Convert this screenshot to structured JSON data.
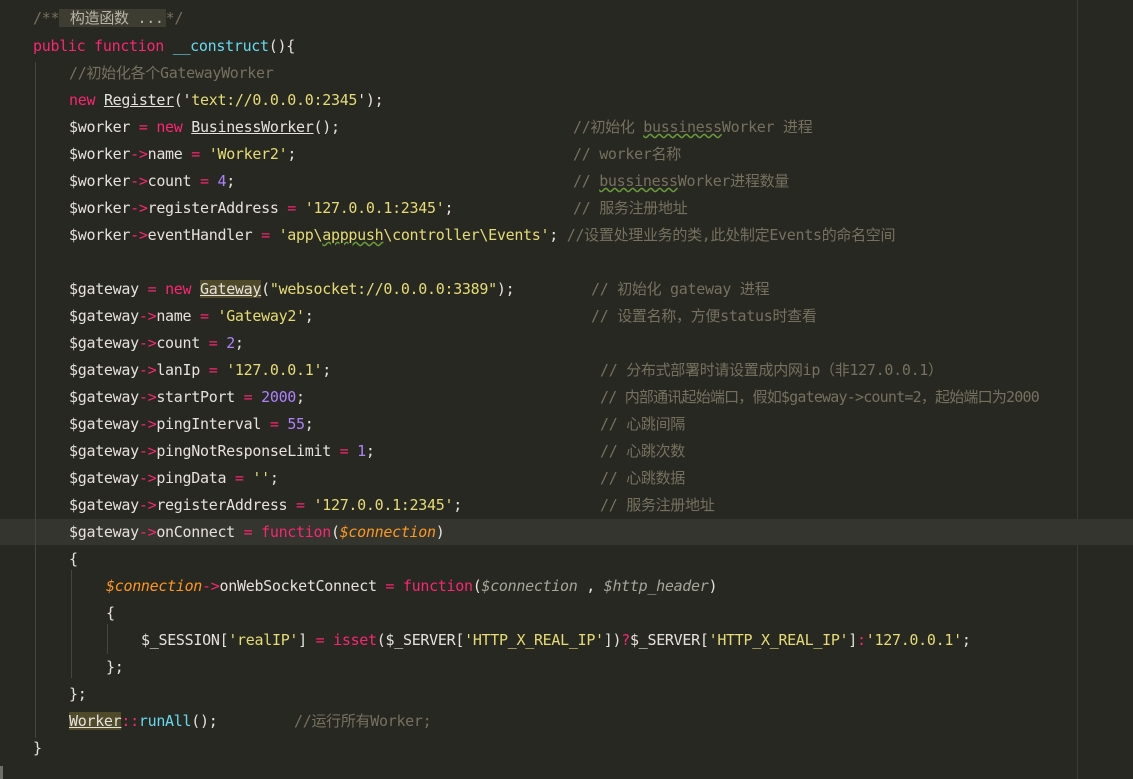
{
  "lines": {
    "l1": {
      "c1": "/**",
      "c2": " 构造函数 ...",
      "c3": "*/"
    },
    "l2": {
      "kw1": "public",
      "kw2": "function",
      "fn": "__construct",
      "p": "(){"
    },
    "l3": {
      "cmt": "//初始化各个GatewayWorker"
    },
    "l4": {
      "kw": "new",
      "cls": "Register",
      "p1": "('",
      "str": "text://0.0.0.0:2345",
      "p2": "');"
    },
    "l5": {
      "var": "$worker",
      "op": " = ",
      "kw": "new",
      "cls": "BusinessWorker",
      "p": "();",
      "cmt1": "//初始化 ",
      "cmtw": "bussiness",
      "cmt2": "Worker 进程"
    },
    "l6": {
      "var": "$worker",
      "arrow": "->",
      "prop": "name",
      "op": " = ",
      "str": "'Worker2'",
      "p": ";",
      "cmt": "// worker名称"
    },
    "l7": {
      "var": "$worker",
      "arrow": "->",
      "prop": "count",
      "op": " = ",
      "num": "4",
      "p": ";",
      "cmt1": "// ",
      "cmtw": "bussiness",
      "cmt2": "Worker进程数量"
    },
    "l8": {
      "var": "$worker",
      "arrow": "->",
      "prop": "registerAddress",
      "op": " = ",
      "str": "'127.0.0.1:2345'",
      "p": ";",
      "cmt": "// 服务注册地址"
    },
    "l9": {
      "var": "$worker",
      "arrow": "->",
      "prop": "eventHandler",
      "op": " = ",
      "str1": "'app\\",
      "strw": "apppush",
      "str2": "\\controller\\Events'",
      "p": ";",
      "cmt": "//设置处理业务的类,此处制定Events的命名空间"
    },
    "l11": {
      "var": "$gateway",
      "op": " = ",
      "kw": "new",
      "cls": "Gateway",
      "p1": "(",
      "str": "\"websocket://0.0.0.0:3389\"",
      "p2": ");",
      "cmt": "// 初始化 gateway 进程"
    },
    "l12": {
      "var": "$gateway",
      "arrow": "->",
      "prop": "name",
      "op": " = ",
      "str": "'Gateway2'",
      "p": ";",
      "cmt": "// 设置名称，方便status时查看"
    },
    "l13": {
      "var": "$gateway",
      "arrow": "->",
      "prop": "count",
      "op": " = ",
      "num": "2",
      "p": ";"
    },
    "l14": {
      "var": "$gateway",
      "arrow": "->",
      "prop": "lanIp",
      "op": " = ",
      "str": "'127.0.0.1'",
      "p": ";",
      "cmt": "// 分布式部署时请设置成内网ip（非127.0.0.1）"
    },
    "l15": {
      "var": "$gateway",
      "arrow": "->",
      "prop": "startPort",
      "op": " = ",
      "num": "2000",
      "p": ";",
      "cmt": "// 内部通讯起始端口，假如$gateway->count=2，起始端口为2000"
    },
    "l16": {
      "var": "$gateway",
      "arrow": "->",
      "prop": "pingInterval",
      "op": " = ",
      "num": "55",
      "p": ";",
      "cmt": "// 心跳间隔"
    },
    "l17": {
      "var": "$gateway",
      "arrow": "->",
      "prop": "pingNotResponseLimit",
      "op": " = ",
      "num": "1",
      "p": ";",
      "cmt": "// 心跳次数"
    },
    "l18": {
      "var": "$gateway",
      "arrow": "->",
      "prop": "pingData",
      "op": " = ",
      "str": "''",
      "p": ";",
      "cmt": "// 心跳数据"
    },
    "l19": {
      "var": "$gateway",
      "arrow": "->",
      "prop": "registerAddress",
      "op": " = ",
      "str": "'127.0.0.1:2345'",
      "p": ";",
      "cmt": "// 服务注册地址"
    },
    "l20": {
      "var": "$gateway",
      "arrow": "->",
      "prop": "onConnect",
      "op": " = ",
      "kw": "function",
      "p1": "(",
      "param": "$connection",
      "p2": ")"
    },
    "l21": {
      "p": "{"
    },
    "l22": {
      "param": "$connection",
      "arrow": "->",
      "prop": "onWebSocketConnect",
      "op": " = ",
      "kw": "function",
      "p1": "(",
      "pa1": "$connection",
      "sep": " , ",
      "pa2": "$http_header",
      "p2": ")"
    },
    "l23": {
      "p": "{"
    },
    "l24": {
      "v1": "$_SESSION",
      "p1": "[",
      "s1": "'realIP'",
      "p2": "]",
      "op1": " = ",
      "fn": "isset",
      "p3": "(",
      "v2": "$_SERVER",
      "p4": "[",
      "s2": "'HTTP_X_REAL_IP'",
      "p5": "])",
      "op2": "?",
      "v3": "$_SERVER",
      "p6": "[",
      "s3": "'HTTP_X_REAL_IP'",
      "p7": "]",
      "op3": ":",
      "s4": "'127.0.0.1'",
      "p8": ";"
    },
    "l25": {
      "p": "};"
    },
    "l26": {
      "p": "};"
    },
    "l27": {
      "cls": "Worker",
      "op": "::",
      "fn": "runAll",
      "p": "();",
      "cmt": "//运行所有Worker;"
    },
    "l28": {
      "p": "}"
    }
  }
}
